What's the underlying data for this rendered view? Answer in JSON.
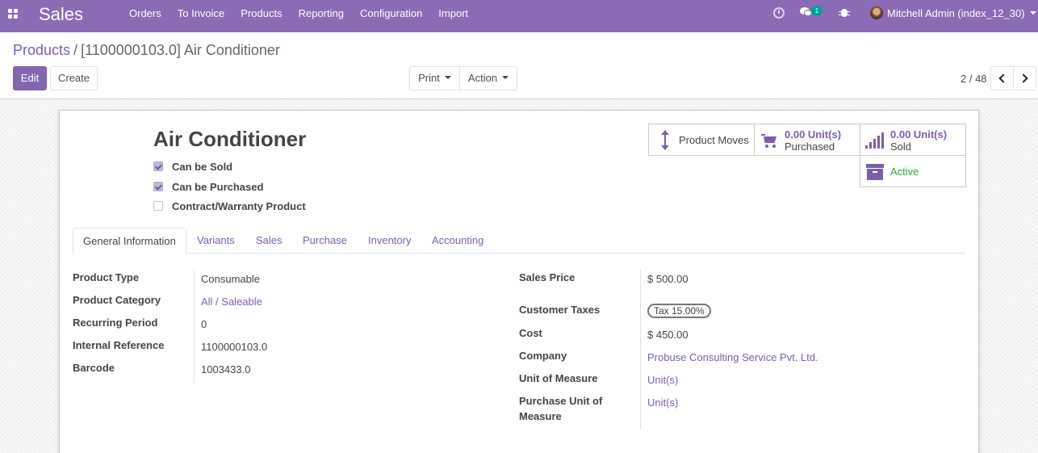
{
  "navbar": {
    "app_name": "Sales",
    "menu": [
      "Orders",
      "To Invoice",
      "Products",
      "Reporting",
      "Configuration",
      "Import"
    ],
    "chat_count": "1",
    "user": "Mitchell Admin (index_12_30)",
    "icons": [
      "apps-grid-icon",
      "clock-icon",
      "chat-icon",
      "bug-icon",
      "avatar"
    ]
  },
  "breadcrumb": {
    "parent": "Products",
    "separator": "/",
    "current": "[1100000103.0] Air Conditioner"
  },
  "toolbar": {
    "edit": "Edit",
    "create": "Create",
    "print": "Print",
    "action": "Action"
  },
  "pager": {
    "text": "2 / 48"
  },
  "product": {
    "name": "Air Conditioner",
    "checkboxes": [
      {
        "label": "Can be Sold",
        "checked": true
      },
      {
        "label": "Can be Purchased",
        "checked": true
      },
      {
        "label": "Contract/Warranty Product",
        "checked": false
      }
    ]
  },
  "smart_buttons": {
    "moves": "Product Moves",
    "purchased_value": "0.00 Unit(s)",
    "purchased_label": "Purchased",
    "sold_value": "0.00 Unit(s)",
    "sold_label": "Sold",
    "active": "Active",
    "active_color": "#28a745"
  },
  "tabs": [
    "General Information",
    "Variants",
    "Sales",
    "Purchase",
    "Inventory",
    "Accounting"
  ],
  "left_fields": [
    {
      "label": "Product Type",
      "value": "Consumable"
    },
    {
      "label": "Product Category",
      "value": "All / Saleable"
    },
    {
      "label": "Recurring Period",
      "value": "0"
    },
    {
      "label": "Internal Reference",
      "value": "1100000103.0"
    },
    {
      "label": "Barcode",
      "value": "1003433.0"
    }
  ],
  "right_fields": {
    "sales_price_label": "Sales Price",
    "sales_price": "$ 500.00",
    "customer_taxes_label": "Customer Taxes",
    "customer_taxes": "Tax 15.00%",
    "cost_label": "Cost",
    "cost": "$ 450.00",
    "company_label": "Company",
    "company": "Probuse Consulting Service Pvt. Ltd.",
    "uom_label": "Unit of Measure",
    "uom": "Unit(s)",
    "purchase_uom_label_1": "Purchase Unit of",
    "purchase_uom_label_2": "Measure",
    "purchase_uom": "Unit(s)"
  },
  "colors": {
    "brand": "#8a6bb4",
    "link": "#7c5ea8"
  }
}
